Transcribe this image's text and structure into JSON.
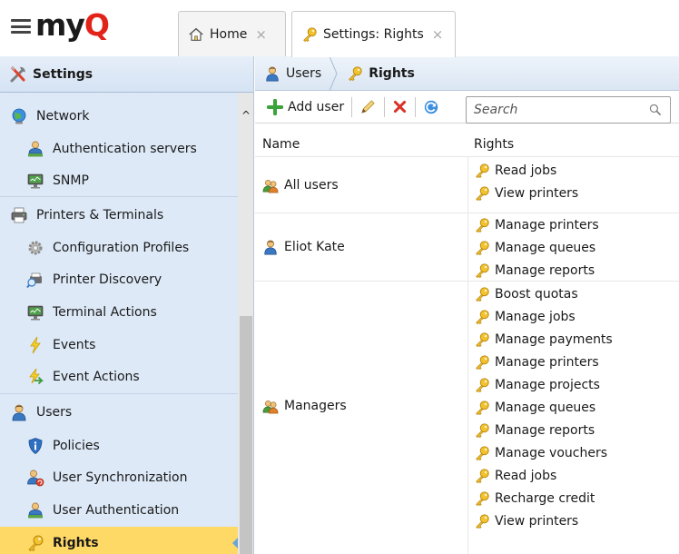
{
  "header": {
    "logo": {
      "text_main": "my",
      "text_q": "Q"
    },
    "tabs": [
      {
        "label": "Home"
      },
      {
        "label": "Settings: Rights"
      }
    ],
    "close_glyph": "×"
  },
  "sidebar": {
    "title": "Settings",
    "items": [
      {
        "label": "Network"
      },
      {
        "label": "Authentication servers"
      },
      {
        "label": "SNMP"
      },
      {
        "label": "Printers & Terminals"
      },
      {
        "label": "Configuration Profiles"
      },
      {
        "label": "Printer Discovery"
      },
      {
        "label": "Terminal Actions"
      },
      {
        "label": "Events"
      },
      {
        "label": "Event Actions"
      },
      {
        "label": "Users"
      },
      {
        "label": "Policies"
      },
      {
        "label": "User Synchronization"
      },
      {
        "label": "User Authentication"
      },
      {
        "label": "Rights"
      }
    ],
    "scroll_up_glyph": "^"
  },
  "breadcrumb": {
    "items": [
      {
        "label": "Users"
      },
      {
        "label": "Rights"
      }
    ]
  },
  "toolbar": {
    "add_label": "Add user",
    "search_placeholder": "Search"
  },
  "table": {
    "columns": [
      "Name",
      "Rights"
    ],
    "rows": [
      {
        "name": "All users",
        "rights": [
          "Read jobs",
          "View printers"
        ]
      },
      {
        "name": "Eliot Kate",
        "rights": [
          "Manage printers",
          "Manage queues",
          "Manage reports"
        ]
      },
      {
        "name": "Managers",
        "rights": [
          "Boost quotas",
          "Manage jobs",
          "Manage payments",
          "Manage printers",
          "Manage projects",
          "Manage queues",
          "Manage reports",
          "Manage vouchers",
          "Read jobs",
          "Recharge credit",
          "View printers"
        ]
      }
    ]
  },
  "colors": {
    "sidebar_bg": "#dde9f7",
    "selected_bg": "#ffd966",
    "brand_red": "#e2231a",
    "accent_blue": "#6aa5d8"
  }
}
